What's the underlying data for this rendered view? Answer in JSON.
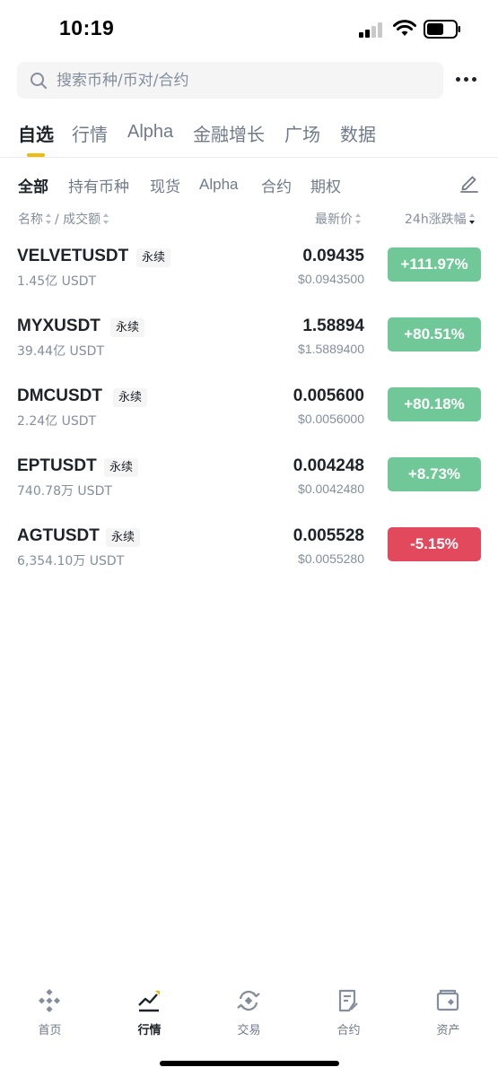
{
  "status_bar": {
    "time": "10:19"
  },
  "search": {
    "placeholder": "搜索币种/币对/合约"
  },
  "main_tabs": [
    "自选",
    "行情",
    "Alpha",
    "金融增长",
    "广场",
    "数据"
  ],
  "sub_tabs": [
    "全部",
    "持有币种",
    "现货",
    "Alpha",
    "合约",
    "期权"
  ],
  "columns": {
    "name": "名称",
    "volume": "/ 成交额",
    "price": "最新价",
    "change": "24h涨跌幅"
  },
  "rows": [
    {
      "symbol": "VELVETUSDT",
      "badge": "永续",
      "volume": "1.45亿 USDT",
      "price": "0.09435",
      "price_usd": "$0.0943500",
      "change": "+111.97%",
      "direction": "up"
    },
    {
      "symbol": "MYXUSDT",
      "badge": "永续",
      "volume": "39.44亿 USDT",
      "price": "1.58894",
      "price_usd": "$1.5889400",
      "change": "+80.51%",
      "direction": "up"
    },
    {
      "symbol": "DMCUSDT",
      "badge": "永续",
      "volume": "2.24亿 USDT",
      "price": "0.005600",
      "price_usd": "$0.0056000",
      "change": "+80.18%",
      "direction": "up"
    },
    {
      "symbol": "EPTUSDT",
      "badge": "永续",
      "volume": "740.78万 USDT",
      "price": "0.004248",
      "price_usd": "$0.0042480",
      "change": "+8.73%",
      "direction": "up"
    },
    {
      "symbol": "AGTUSDT",
      "badge": "永续",
      "volume": "6,354.10万 USDT",
      "price": "0.005528",
      "price_usd": "$0.0055280",
      "change": "-5.15%",
      "direction": "down"
    }
  ],
  "bottom_nav": [
    {
      "label": "首页",
      "icon": "home-icon"
    },
    {
      "label": "行情",
      "icon": "markets-icon"
    },
    {
      "label": "交易",
      "icon": "trade-icon"
    },
    {
      "label": "合约",
      "icon": "futures-icon"
    },
    {
      "label": "资产",
      "icon": "wallet-icon"
    }
  ],
  "colors": {
    "accent": "#f0b90b",
    "up": "#58be86",
    "down": "#e2495d",
    "text": "#1e2329",
    "muted": "#848e9c"
  }
}
